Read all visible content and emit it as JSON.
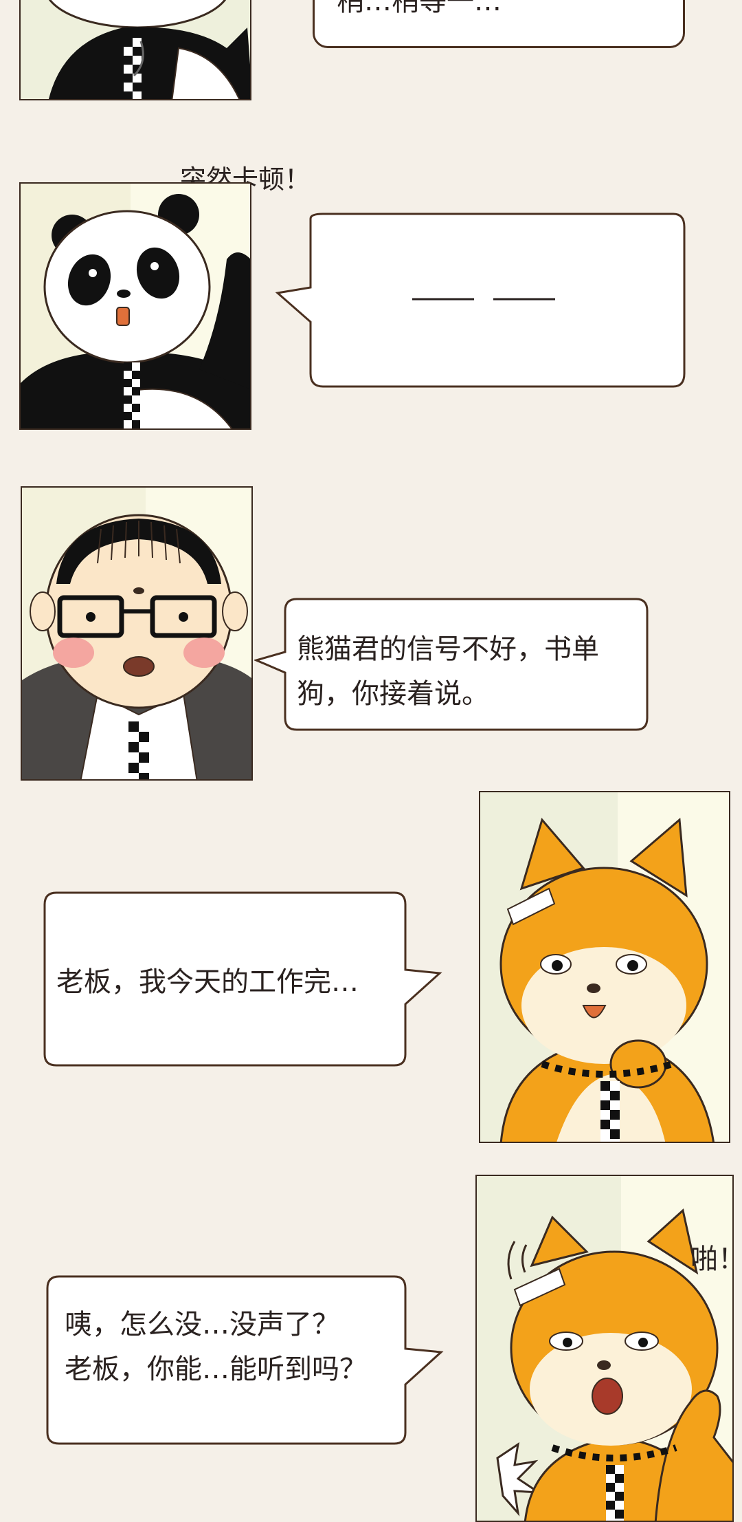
{
  "panels": [
    {
      "character": "panda",
      "caption": "",
      "bubble": {
        "text": "稍…稍等一…"
      }
    },
    {
      "character": "panda",
      "caption": "突然卡顿！",
      "bubble": {
        "text": ""
      }
    },
    {
      "character": "boss",
      "bubble": {
        "line1": "熊猫君的信号不好，书单",
        "line2": "狗，你接着说。"
      }
    },
    {
      "character": "shiba",
      "bubble": {
        "text": "老板，我今天的工作完…"
      }
    },
    {
      "character": "shiba",
      "fx": "啪！",
      "bubble": {
        "line1": "咦，怎么没…没声了？",
        "line2": "老板，你能…能听到吗？"
      }
    }
  ],
  "colors": {
    "background": "#f5f0e8",
    "panel_bg": "#f7f4dc",
    "panda_black": "#111111",
    "shiba_orange": "#f3a21a",
    "shiba_cream": "#fcf1d8",
    "boss_suit": "#4a4745",
    "cheek": "#f4a6a0",
    "outline": "#4a3020"
  },
  "icons": [
    "panda-character",
    "boss-character",
    "shiba-character",
    "checkered-tie",
    "static-burst-icon"
  ]
}
